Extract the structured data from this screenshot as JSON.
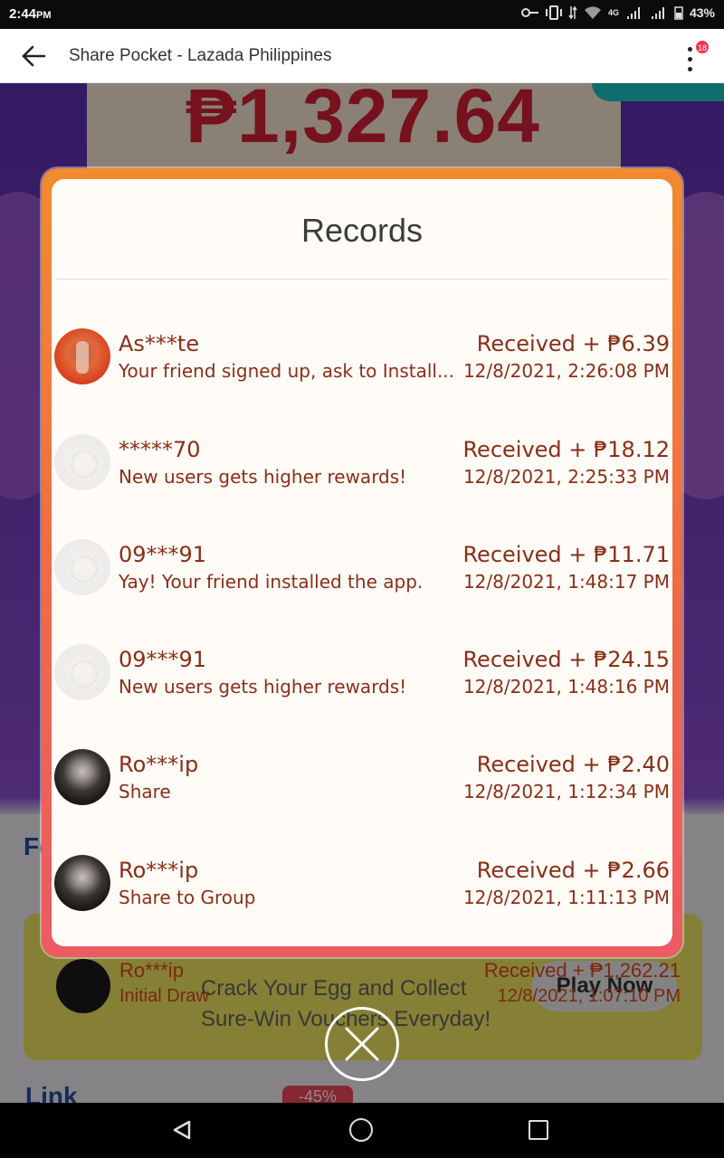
{
  "status_bar": {
    "time": "2:44",
    "time_suffix": "PM",
    "network": "4G",
    "battery": "43%"
  },
  "app_bar": {
    "title": "Share Pocket - Lazada Philippines",
    "notification_badge": "18"
  },
  "background": {
    "amount": "₱1,327.64",
    "section_heading_partial": "Fo",
    "banner_text_line1": "Crack Your Egg and Collect",
    "banner_text_line2": "Sure-Win Vouchers Everyday!",
    "play_now": "Play Now",
    "link_partial": "Link",
    "discount": "-45%",
    "peek_record": {
      "name": "Ro***ip",
      "subtitle": "Initial Draw",
      "amount": "Received + ₱1,262.21",
      "time": "12/8/2021, 1:07:10 PM"
    }
  },
  "modal": {
    "title": "Records",
    "records": [
      {
        "name": "As***te",
        "subtitle": "Your friend signed up, ask to Install...",
        "amount": "Received + ₱6.39",
        "time": "12/8/2021, 2:26:08 PM",
        "avatar": "orange"
      },
      {
        "name": "*****70",
        "subtitle": "New users gets higher rewards!",
        "amount": "Received + ₱18.12",
        "time": "12/8/2021, 2:25:33 PM",
        "avatar": "blank"
      },
      {
        "name": "09***91",
        "subtitle": "Yay! Your friend installed the app.",
        "amount": "Received + ₱11.71",
        "time": "12/8/2021, 1:48:17 PM",
        "avatar": "blank"
      },
      {
        "name": "09***91",
        "subtitle": "New users gets higher rewards!",
        "amount": "Received + ₱24.15",
        "time": "12/8/2021, 1:48:16 PM",
        "avatar": "blank"
      },
      {
        "name": "Ro***ip",
        "subtitle": "Share",
        "amount": "Received + ₱2.40",
        "time": "12/8/2021, 1:12:34 PM",
        "avatar": "dark"
      },
      {
        "name": "Ro***ip",
        "subtitle": "Share to Group",
        "amount": "Received + ₱2.66",
        "time": "12/8/2021, 1:11:13 PM",
        "avatar": "dark"
      }
    ]
  },
  "colors": {
    "accent_orange": "#f18b2e",
    "accent_pink": "#ec5a63",
    "record_text": "#8a2e16",
    "price_red": "#d52236"
  }
}
